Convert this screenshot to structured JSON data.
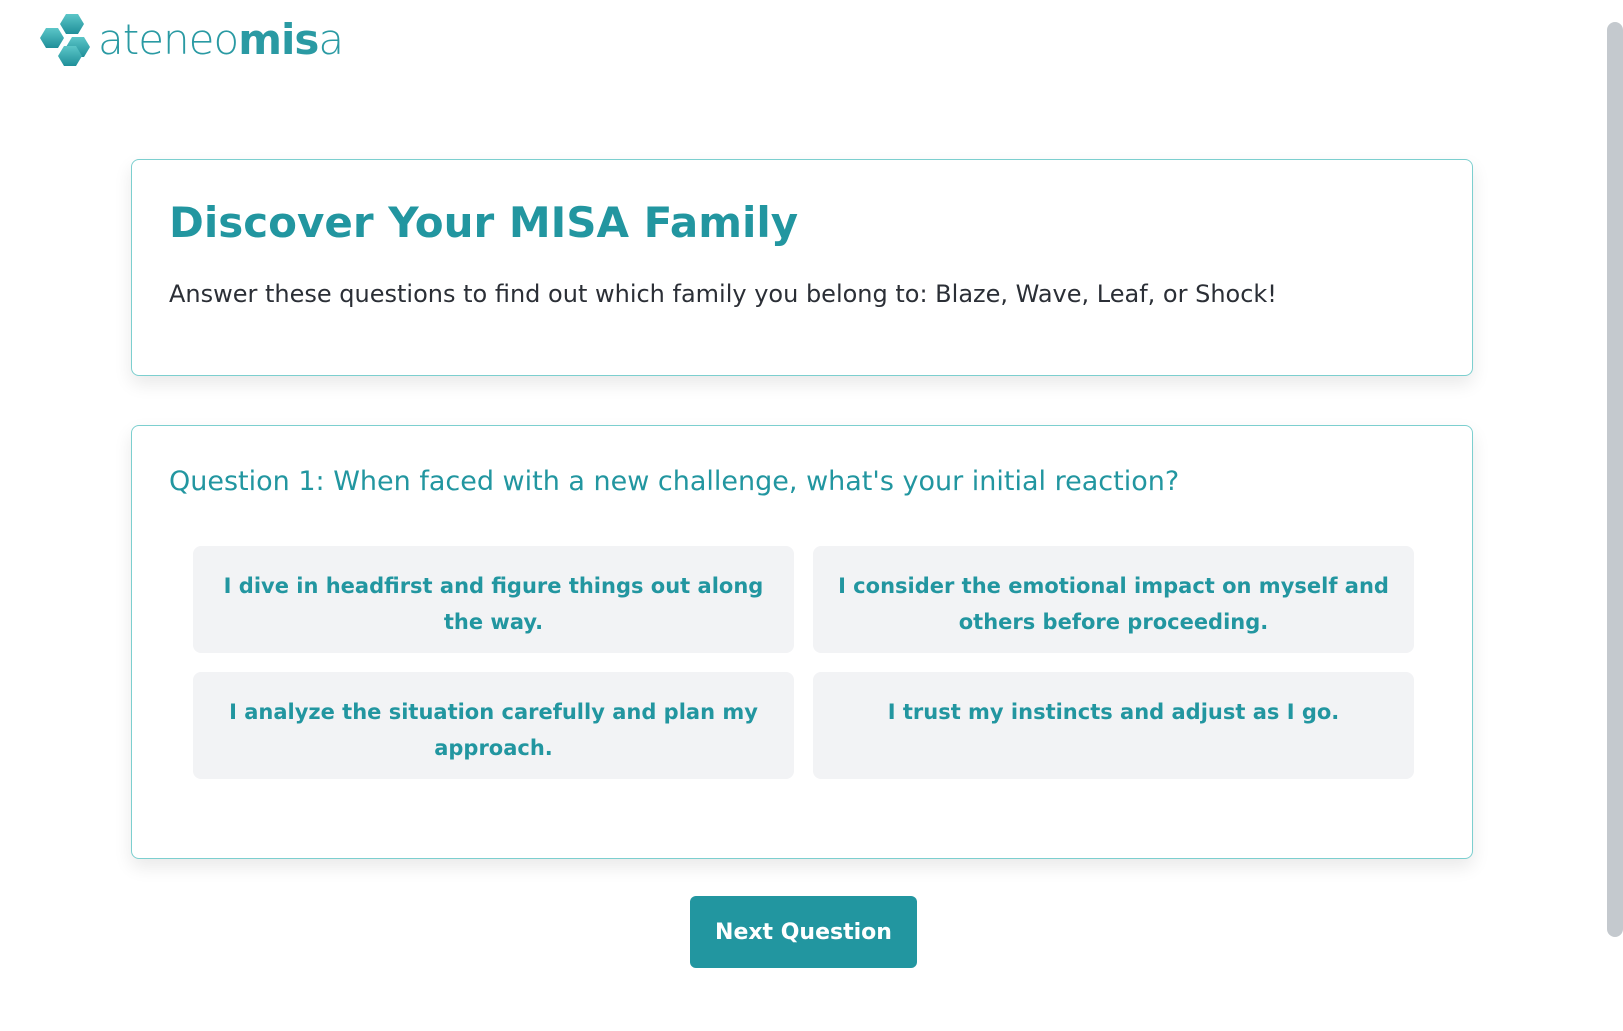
{
  "logo": {
    "icon": "hexagon-cluster-logo",
    "text_light": "ateneo",
    "text_bold": "mis",
    "text_end": "a"
  },
  "intro": {
    "title": "Discover Your MISA Family",
    "description": "Answer these questions to find out which family you belong to: Blaze, Wave, Leaf, or Shock!"
  },
  "question": {
    "text": "Question 1: When faced with a new challenge, what's your initial reaction?",
    "options": [
      {
        "label": "I dive in headfirst and figure things out along the way."
      },
      {
        "label": "I consider the emotional impact on myself and others before proceeding."
      },
      {
        "label": "I analyze the situation carefully and plan my approach."
      },
      {
        "label": "I trust my instincts and adjust as I go."
      }
    ]
  },
  "actions": {
    "next_label": "Next Question"
  },
  "colors": {
    "accent": "#2296a0",
    "card_border": "#7ccfcf",
    "option_bg": "#f2f3f5",
    "body_text": "#2b2f36"
  }
}
